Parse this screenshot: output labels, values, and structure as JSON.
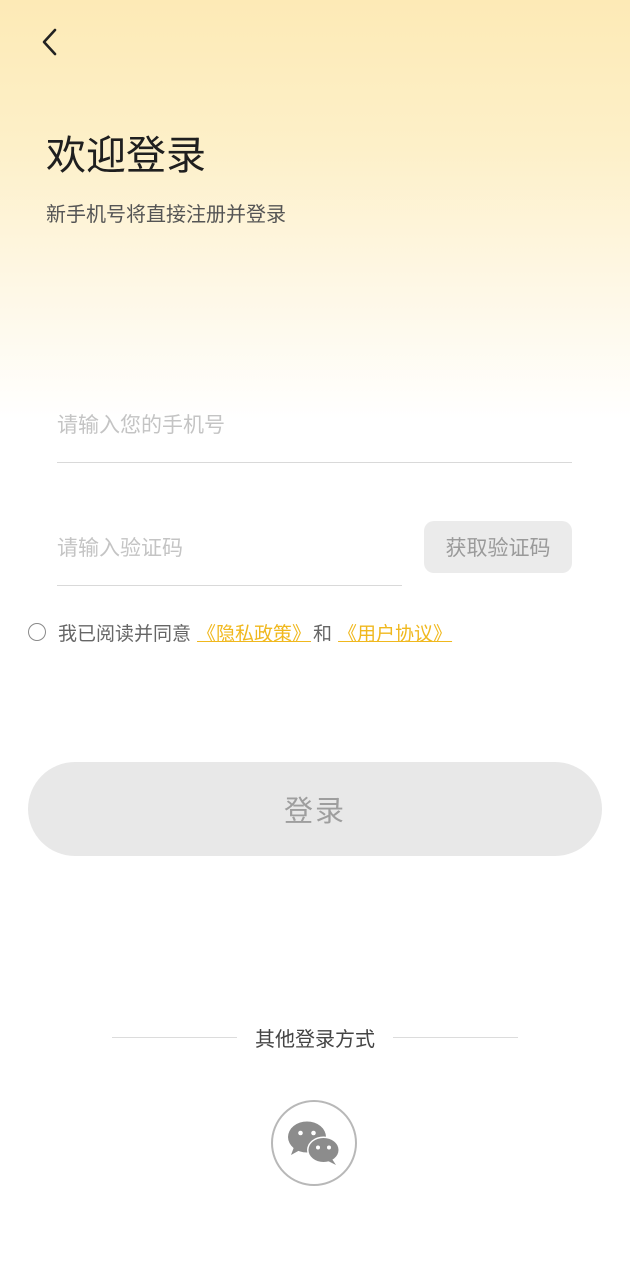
{
  "header": {
    "back_icon": "chevron-left-icon",
    "title": "欢迎登录",
    "subtitle": "新手机号将直接注册并登录"
  },
  "form": {
    "phone_placeholder": "请输入您的手机号",
    "phone_value": "",
    "code_placeholder": "请输入验证码",
    "code_value": "",
    "get_code_label": "获取验证码"
  },
  "agreement": {
    "checked": false,
    "prefix": "我已阅读并同意",
    "privacy_link": "《隐私政策》",
    "and": "和",
    "terms_link": "《用户协议》"
  },
  "login": {
    "button_label": "登录"
  },
  "other_login": {
    "label": "其他登录方式",
    "wechat_icon": "wechat-icon"
  },
  "colors": {
    "accent": "#f0b81e",
    "gradient_top": "#fdeab6",
    "button_disabled_bg": "#e8e8e8",
    "button_disabled_text": "#9e9e9e"
  }
}
